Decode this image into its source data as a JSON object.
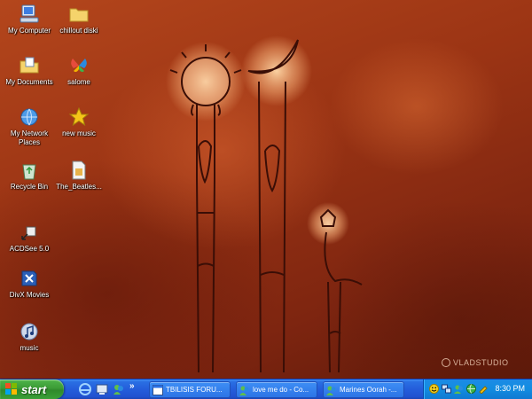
{
  "desktop": {
    "icons": [
      {
        "label": "My Computer",
        "icon": "my-computer-icon"
      },
      {
        "label": "chillout diski",
        "icon": "folder-icon"
      },
      {
        "label": "My Documents",
        "icon": "my-documents-icon"
      },
      {
        "label": "salome",
        "icon": "msn-butterfly-icon"
      },
      {
        "label": "My Network Places",
        "icon": "network-places-icon"
      },
      {
        "label": "new music",
        "icon": "star-icon"
      },
      {
        "label": "Recycle Bin",
        "icon": "recycle-bin-icon"
      },
      {
        "label": "The_Beatles...",
        "icon": "file-icon"
      },
      {
        "label": "ACDSee 5.0",
        "icon": "acdsee-icon"
      },
      {
        "label": "DivX Movies",
        "icon": "divx-icon"
      },
      {
        "label": "music",
        "icon": "music-note-icon"
      }
    ],
    "watermark": "VLADSTUDIO"
  },
  "taskbar": {
    "start_label": "start",
    "quick_launch": [
      "internet-explorer-icon",
      "show-desktop-icon",
      "messenger-icon"
    ],
    "more_label": "»",
    "tasks": [
      {
        "label": "TBILISIS FORU...",
        "icon": "ie-window-icon"
      },
      {
        "label": "love me do - Co...",
        "icon": "msn-chat-icon"
      },
      {
        "label": "Marines Oorah -...",
        "icon": "msn-chat-icon"
      }
    ],
    "tray_icons": [
      "smiley-icon",
      "network-icon",
      "msn-icon",
      "globe-icon",
      "volume-icon",
      "tools-icon"
    ],
    "clock": "8:30 PM"
  },
  "colors": {
    "taskbar_blue": "#245ddb",
    "start_green": "#3c9b36",
    "tray_blue": "#128ce0",
    "wallpaper_rust": "#9b3414"
  }
}
